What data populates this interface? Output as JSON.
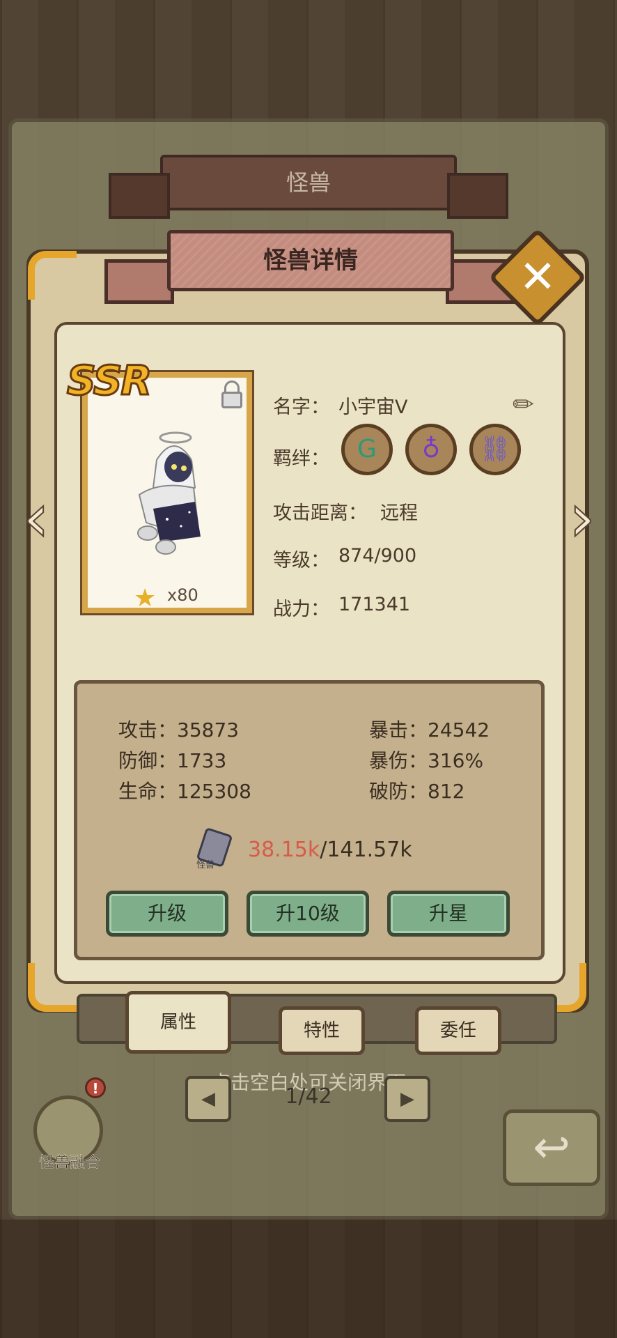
{
  "back_panel": {
    "title": "怪兽"
  },
  "dialog": {
    "title": "怪兽详情"
  },
  "portrait": {
    "rarity": "SSR",
    "star_count": "x80"
  },
  "info": {
    "name_label": "名字：",
    "name_value": "小宇宙Ⅴ",
    "bond_label": "羁绊：",
    "bonds": [
      "G",
      "♁",
      "⛓"
    ],
    "range_label": "攻击距离：",
    "range_value": "远程",
    "level_label": "等级：",
    "level_value": "874/900",
    "power_label": "战力：",
    "power_value": "171341"
  },
  "stats": {
    "attack": "攻击：35873",
    "defense": "防御：1733",
    "hp": "生命：125308",
    "crit": "暴击：24542",
    "crit_dmg": "暴伤：316%",
    "armor_pen": "破防：812",
    "exp_icon_text": "怪兽",
    "exp_current": "38.15k",
    "exp_total": "/141.57k"
  },
  "buttons": {
    "level_up": "升级",
    "level_up_10": "升10级",
    "star_up": "升星"
  },
  "tabs": {
    "attributes": "属性",
    "traits": "特性",
    "commission": "委任"
  },
  "footer": {
    "hint": "点击空白处可关闭界面",
    "page": "1/42",
    "fusion_label": "怪兽融合",
    "badge": "!"
  },
  "colors": {
    "accent_gold": "#e6a62c",
    "button_green": "#7fae8a",
    "exp_red": "#d85a4a"
  }
}
